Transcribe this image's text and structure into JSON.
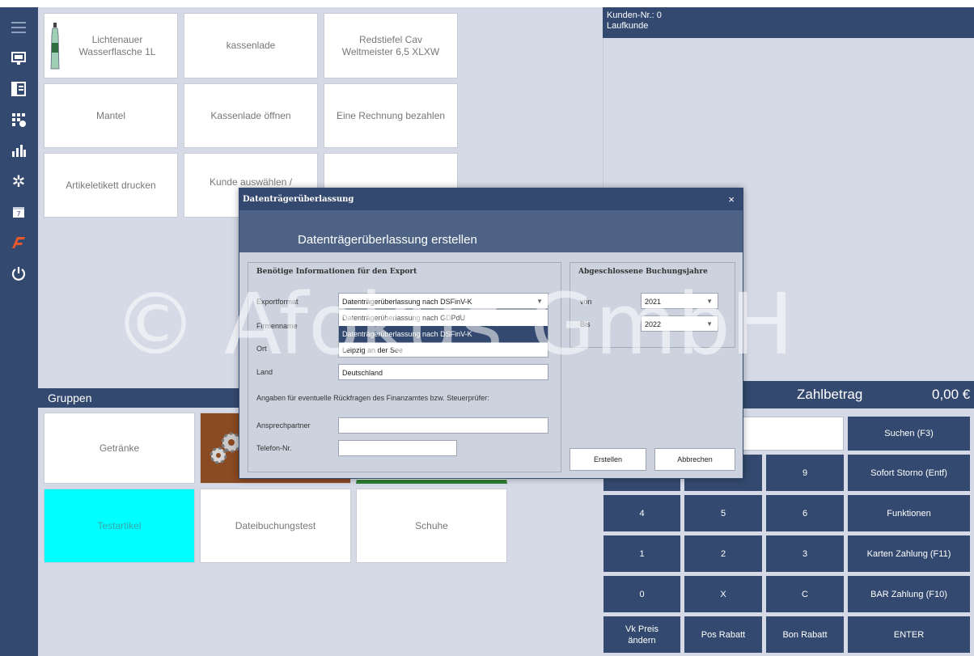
{
  "sidebar": {
    "icons": [
      "menu-icon",
      "monitor-icon",
      "layout-icon",
      "grid-settings-icon",
      "bar-chart-icon",
      "gear-icon",
      "calendar-icon",
      "logo-icon",
      "power-icon"
    ]
  },
  "tiles": [
    {
      "label": "Lichtenauer\nWasserflasche 1L"
    },
    {
      "label": "kassenlade"
    },
    {
      "label": "Redstiefel Cav\nWeltmeister 6,5 XLXW"
    },
    {
      "label": "Mantel"
    },
    {
      "label": "Kassenlade öffnen"
    },
    {
      "label": "Eine Rechnung bezahlen"
    },
    {
      "label": "Artikeletikett drucken"
    },
    {
      "label": "Kunde auswählen /"
    },
    {
      "label": ""
    }
  ],
  "customer": {
    "number": "Kunden-Nr.: 0",
    "name": "Laufkunde"
  },
  "gruppen": {
    "title": "Gruppen",
    "tiles": [
      "Getränke",
      "",
      "",
      "Testartikel",
      "Dateibuchungstest",
      "Schuhe"
    ]
  },
  "payment": {
    "label": "Zahlbetrag",
    "amount": "0,00 €",
    "keys": {
      "suchen": "Suchen (F3)",
      "sofort_storno": "Sofort Storno (Entf)",
      "funktionen": "Funktionen",
      "karten": "Karten Zahlung (F11)",
      "bar": "BAR Zahlung (F10)",
      "enter": "ENTER",
      "k9": "9",
      "k4": "4",
      "k5": "5",
      "k6": "6",
      "k1": "1",
      "k2": "2",
      "k3": "3",
      "k0": "0",
      "kx": "X",
      "kc": "C",
      "vk_preis": "Vk Preis\nändern",
      "pos_rabatt": "Pos Rabatt",
      "bon_rabatt": "Bon Rabatt"
    }
  },
  "watermark": "© Afokus GmbH",
  "modal": {
    "title": "Datenträgerüberlassung",
    "close": "×",
    "header": "Datenträgerüberlassung erstellen",
    "export": {
      "legend": "Benötige Informationen für den Export",
      "format_label": "Exportformat",
      "format_value": "Datenträgerüberlassung nach DSFinV-K",
      "options": [
        "Datenträgerüberlassung nach GDPdU",
        "Datenträgerüberlassung nach DSFinV-K"
      ],
      "firma_label": "Firmenname",
      "ort_label": "Ort",
      "ort_value": "Leipzig an der See",
      "land_label": "Land",
      "land_value": "Deutschland",
      "hint": "Angaben für eventuelle Rückfragen des Finanzamtes bzw. Steuerprüfer:",
      "ansprech_label": "Ansprechpartner",
      "ansprech_value": "",
      "telefon_label": "Telefon-Nr.",
      "telefon_value": ""
    },
    "years": {
      "legend": "Abgeschlossene Buchungsjahre",
      "von_label": "von",
      "von_value": "2021",
      "bis_label": "Bis",
      "bis_value": "2022"
    },
    "buttons": {
      "create": "Erstellen",
      "cancel": "Abbrechen"
    }
  }
}
